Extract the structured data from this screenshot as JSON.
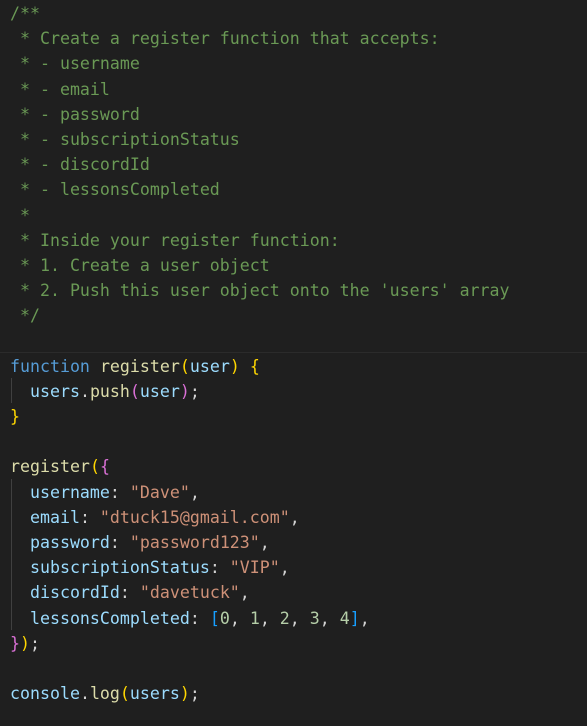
{
  "comment": {
    "open": "/**",
    "lines": [
      " * Create a register function that accepts:",
      " * - username",
      " * - email",
      " * - password",
      " * - subscriptionStatus",
      " * - discordId",
      " * - lessonsCompleted",
      " *",
      " * Inside your register function:",
      " * 1. Create a user object",
      " * 2. Push this user object onto the 'users' array"
    ],
    "close": " */"
  },
  "func_def": {
    "keyword": "function",
    "name": "register",
    "param": "user",
    "body_obj": "users",
    "body_method": "push",
    "body_arg": "user"
  },
  "call": {
    "name": "register",
    "fields": [
      {
        "key": "username",
        "value": "\"Dave\""
      },
      {
        "key": "email",
        "value": "\"dtuck15@gmail.com\""
      },
      {
        "key": "password",
        "value": "\"password123\""
      },
      {
        "key": "subscriptionStatus",
        "value": "\"VIP\""
      },
      {
        "key": "discordId",
        "value": "\"davetuck\""
      }
    ],
    "lessons_key": "lessonsCompleted",
    "lessons_values": [
      "0",
      "1",
      "2",
      "3",
      "4"
    ]
  },
  "log": {
    "obj": "console",
    "method": "log",
    "arg": "users"
  },
  "colors": {
    "background": "#1f1f1f",
    "comment": "#6a9955",
    "keyword": "#569cd6",
    "function": "#dcdcaa",
    "variable": "#9cdcfe",
    "string": "#ce9178",
    "number": "#b5cea8",
    "bracket_level1": "#ffd700",
    "bracket_level2": "#da70d6",
    "bracket_level3": "#179fff"
  }
}
